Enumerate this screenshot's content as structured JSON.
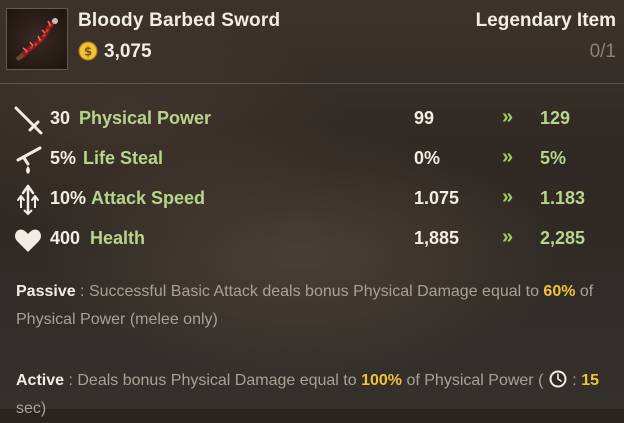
{
  "item": {
    "name": "Bloody Barbed Sword",
    "price": "3,075",
    "rarity": "Legendary Item",
    "stack": "0/1"
  },
  "stats": [
    {
      "icon": "sword-icon",
      "amount": "30",
      "name": "Physical Power",
      "base": "99",
      "arrow": "»",
      "new": "129"
    },
    {
      "icon": "life-steal-icon",
      "amount": "5%",
      "name": "Life Steal",
      "base": "0%",
      "arrow": "»",
      "new": "5%"
    },
    {
      "icon": "attack-speed-icon",
      "amount": "10%",
      "name": "Attack Speed",
      "base": "1.075",
      "arrow": "»",
      "new": "1.183"
    },
    {
      "icon": "heart-icon",
      "amount": "400",
      "name": "Health",
      "base": "1,885",
      "arrow": "»",
      "new": "2,285"
    }
  ],
  "passive": {
    "label": "Passive",
    "sep": " : ",
    "text1": "Successful Basic Attack deals bonus Physical Damage equal to ",
    "value": "60%",
    "text2": " of Physical Power (melee only)"
  },
  "active": {
    "label": "Active",
    "sep": " : ",
    "text1": "Deals bonus Physical Damage equal to ",
    "value": "100%",
    "text2": " of Physical Power ( ",
    "sep2": " : ",
    "cooldown": "15",
    "unit": " sec)"
  },
  "colors": {
    "stat_name": "#b6d48c",
    "arrow": "#9fcf5a",
    "highlight": "#f0c23a",
    "muted": "#a8a196"
  }
}
